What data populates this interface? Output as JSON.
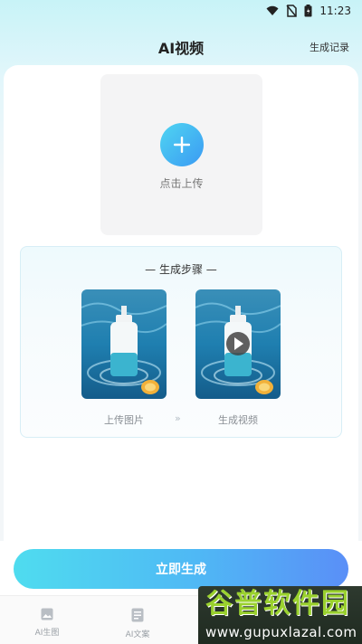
{
  "status_bar": {
    "time": "11:23"
  },
  "header": {
    "title": "AI视频",
    "records_label": "生成记录"
  },
  "upload": {
    "label": "点击上传"
  },
  "steps": {
    "title": "— 生成步骤 —",
    "step1_label": "上传图片",
    "step2_label": "生成视频",
    "arrow": "»"
  },
  "actions": {
    "generate_label": "立即生成"
  },
  "tabbar": {
    "tabs": [
      {
        "label": "AI生图",
        "icon": "image-icon"
      },
      {
        "label": "AI文案",
        "icon": "document-icon"
      }
    ]
  },
  "watermark": {
    "text": "谷普软件园",
    "url": "www.gupuxlazal.com"
  },
  "colors": {
    "accent_start": "#4fdcef",
    "accent_end": "#5a8ff7"
  }
}
